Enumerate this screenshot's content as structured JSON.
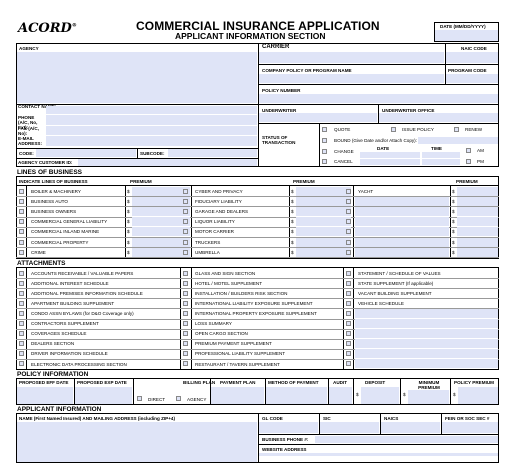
{
  "header": {
    "logo": "ACORD",
    "logo_mark": "®",
    "title": "COMMERCIAL INSURANCE APPLICATION",
    "subtitle": "APPLICANT INFORMATION SECTION",
    "date_label": "DATE (MM/DD/YYYY)"
  },
  "agency": {
    "agency": "AGENCY",
    "contact_name": "CONTACT NAME:",
    "phone": "PHONE (A/C, No, Ext):",
    "fax": "FAX (A/C, No):",
    "email": "E-MAIL ADDRESS:",
    "code": "CODE:",
    "subcode": "SUBCODE:",
    "customer_id": "AGENCY CUSTOMER ID:"
  },
  "carrier": {
    "carrier": "CARRIER",
    "naic": "NAIC CODE",
    "company_policy": "COMPANY POLICY OR PROGRAM NAME",
    "program_code": "PROGRAM CODE",
    "policy_number": "POLICY NUMBER",
    "underwriter": "UNDERWRITER",
    "underwriter_office": "UNDERWRITER OFFICE",
    "status": "STATUS OF TRANSACTION",
    "quote": "QUOTE",
    "issue_policy": "ISSUE POLICY",
    "renew": "RENEW",
    "bound": "BOUND (Give Date and/or Attach Copy):",
    "change": "CHANGE",
    "date": "DATE",
    "time": "TIME",
    "cancel": "CANCEL",
    "am": "AM",
    "pm": "PM"
  },
  "lines": {
    "heading": "LINES OF BUSINESS",
    "indicate": "INDICATE LINES OF BUSINESS",
    "premium": "PREMIUM",
    "dollar": "$",
    "col1": [
      "BOILER & MACHINERY",
      "BUSINESS AUTO",
      "BUSINESS OWNERS",
      "COMMERCIAL GENERAL LIABILITY",
      "COMMERCIAL INLAND MARINE",
      "COMMERCIAL PROPERTY",
      "CRIME"
    ],
    "col2": [
      "CYBER AND PRIVACY",
      "FIDUCIARY LIABILITY",
      "GARAGE AND DEALERS",
      "LIQUOR LIABILITY",
      "MOTOR CARRIER",
      "TRUCKERS",
      "UMBRELLA"
    ],
    "col3": [
      "YACHT"
    ]
  },
  "attachments": {
    "heading": "ATTACHMENTS",
    "col1": [
      "ACCOUNTS RECEIVABLE / VALUABLE PAPERS",
      "ADDITIONAL INTEREST SCHEDULE",
      "ADDITIONAL PREMISES INFORMATION SCHEDULE",
      "APARTMENT BUILDING SUPPLEMENT",
      "CONDO ASSN BYLAWS (for D&O Coverage only)",
      "CONTRACTORS SUPPLEMENT",
      "COVERAGES SCHEDULE",
      "DEALERS SECTION",
      "DRIVER INFORMATION SCHEDULE",
      "ELECTRONIC DATA PROCESSING SECTION"
    ],
    "col2": [
      "GLASS AND SIGN SECTION",
      "HOTEL / MOTEL SUPPLEMENT",
      "INSTALLATION / BUILDERS RISK SECTION",
      "INTERNATIONAL LIABILITY EXPOSURE SUPPLEMENT",
      "INTERNATIONAL PROPERTY EXPOSURE SUPPLEMENT",
      "LOSS SUMMARY",
      "OPEN CARGO SECTION",
      "PREMIUM PAYMENT SUPPLEMENT",
      "PROFESSIONAL LIABILITY SUPPLEMENT",
      "RESTAURANT / TAVERN SUPPLEMENT"
    ],
    "col3": [
      "STATEMENT / SCHEDULE OF VALUES",
      "STATE SUPPLEMENT (If applicable)",
      "VACANT BUILDING SUPPLEMENT",
      "VEHICLE SCHEDULE"
    ]
  },
  "policy": {
    "heading": "POLICY INFORMATION",
    "eff": "PROPOSED EFF DATE",
    "exp": "PROPOSED EXP DATE",
    "billing": "BILLING PLAN",
    "direct": "DIRECT",
    "agency": "AGENCY",
    "payment_plan": "PAYMENT PLAN",
    "method": "METHOD OF PAYMENT",
    "audit": "AUDIT",
    "deposit": "DEPOSIT",
    "minimum": "MINIMUM PREMIUM",
    "policy_premium": "POLICY PREMIUM"
  },
  "applicant": {
    "heading": "APPLICANT INFORMATION",
    "name": "NAME (First Named Insured) AND MAILING ADDRESS (including ZIP+4)",
    "gl": "GL CODE",
    "sic": "SIC",
    "naics": "NAICS",
    "fein": "FEIN OR SOC SEC #",
    "phone": "BUSINESS PHONE #:",
    "website": "WEBSITE ADDRESS"
  }
}
